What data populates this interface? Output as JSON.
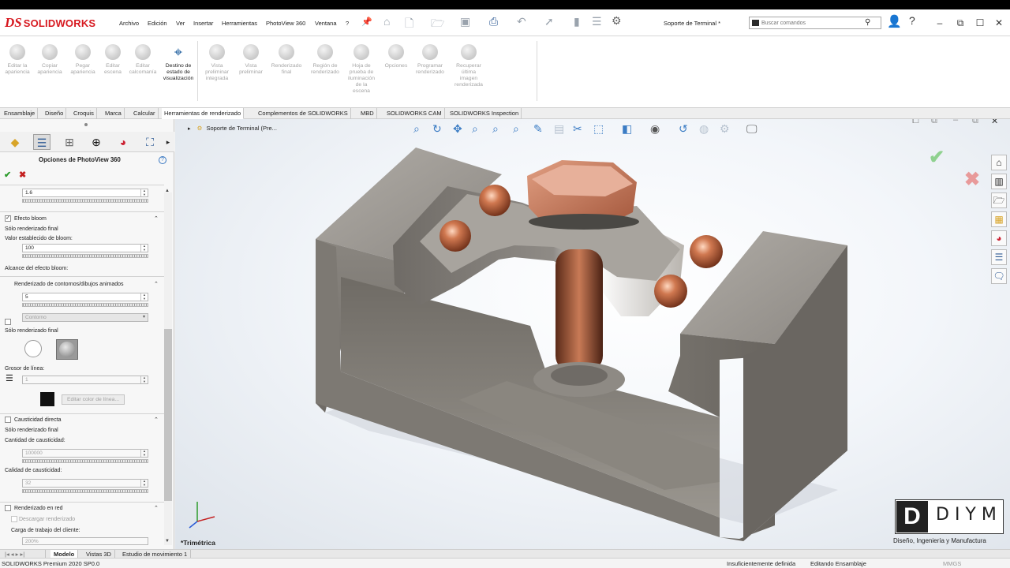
{
  "app": {
    "brand": "SOLIDWORKS",
    "document_title": "Soporte de Terminal *"
  },
  "menu": [
    "Archivo",
    "Edición",
    "Ver",
    "Insertar",
    "Herramientas",
    "PhotoView 360",
    "Ventana",
    "?"
  ],
  "search": {
    "placeholder": "Buscar comandos"
  },
  "ribbon": [
    {
      "label": "Editar la apariencia",
      "lines": [
        "Editar la",
        "apariencia"
      ]
    },
    {
      "label": "Copiar apariencia",
      "lines": [
        "Copiar",
        "apariencia"
      ]
    },
    {
      "label": "Pegar apariencia",
      "lines": [
        "Pegar",
        "apariencia"
      ]
    },
    {
      "label": "Editar escena",
      "lines": [
        "Editar",
        "escena"
      ]
    },
    {
      "label": "Editar calcomanía",
      "lines": [
        "Editar",
        "calcomanía"
      ]
    },
    {
      "label": "Destino de estado de visualización",
      "lines": [
        "Destino de",
        "estado de",
        "visualización"
      ]
    },
    {
      "label": "Vista preliminar integrada",
      "lines": [
        "Vista",
        "preliminar",
        "integrada"
      ]
    },
    {
      "label": "Vista preliminar",
      "lines": [
        "Vista",
        "preliminar"
      ]
    },
    {
      "label": "Renderizado final",
      "lines": [
        "Renderizado",
        "final"
      ]
    },
    {
      "label": "Región de renderizado",
      "lines": [
        "Región de",
        "renderizado"
      ]
    },
    {
      "label": "Hoja de prueba de iluminación de la escena",
      "lines": [
        "Hoja de",
        "prueba de",
        "iluminación",
        "de la",
        "escena"
      ]
    },
    {
      "label": "Opciones",
      "lines": [
        "Opciones"
      ]
    },
    {
      "label": "Programar renderizado",
      "lines": [
        "Programar",
        "renderizado"
      ]
    },
    {
      "label": "Recuperar última imagen renderizada",
      "lines": [
        "Recuperar",
        "última",
        "imagen",
        "renderizada"
      ]
    }
  ],
  "tabs": [
    "Ensamblaje",
    "Diseño",
    "Croquis",
    "Marca",
    "Calcular",
    "Herramientas de renderizado",
    "Complementos de SOLIDWORKS",
    "MBD",
    "SOLIDWORKS CAM",
    "SOLIDWORKS Inspection"
  ],
  "active_tab": "Herramientas de renderizado",
  "panel": {
    "title": "Opciones de PhotoView 360",
    "top_value": "1.6",
    "bloom": {
      "header": "Efecto bloom",
      "only_final": "Sólo renderizado final",
      "value_label": "Valor establecido de bloom:",
      "value": "100",
      "reach_label": "Alcance del efecto bloom:"
    },
    "contour": {
      "header": "Renderizado de contornos/dibujos animados",
      "value": "5",
      "mode": "Contorno",
      "only_final": "Sólo renderizado final",
      "line_label": "Grosor de línea:",
      "line_value": "1",
      "color_button": "Editar color de línea..."
    },
    "caustic": {
      "header": "Causticidad directa",
      "only_final": "Sólo renderizado final",
      "amount_label": "Cantidad de causticidad:",
      "amount": "100000",
      "quality_label": "Calidad de causticidad:",
      "quality": "32"
    },
    "network": {
      "header": "Renderizado en red",
      "download": "Descargar renderizado",
      "load_label": "Carga de trabajo del cliente:",
      "load": "200%"
    }
  },
  "viewport": {
    "tree_item": "Soporte de Terminal  (Pre...",
    "view_name": "*Trimétrica"
  },
  "watermark": {
    "name": "DIYM",
    "letter": "D",
    "tagline": "Diseño, Ingeniería y Manufactura"
  },
  "bottom_tabs": [
    "Modelo",
    "Vistas 3D",
    "Estudio de movimiento 1"
  ],
  "status": {
    "version": "SOLIDWORKS Premium 2020 SP0.0",
    "definition": "Insuficientemente definida",
    "mode": "Editando Ensamblaje",
    "units": "MMGS"
  },
  "colors": {
    "accent": "#d71920",
    "ok": "#2c9b2c",
    "cancel": "#c42020",
    "part_body": "#8f8b85",
    "copper": "#c46a45"
  }
}
